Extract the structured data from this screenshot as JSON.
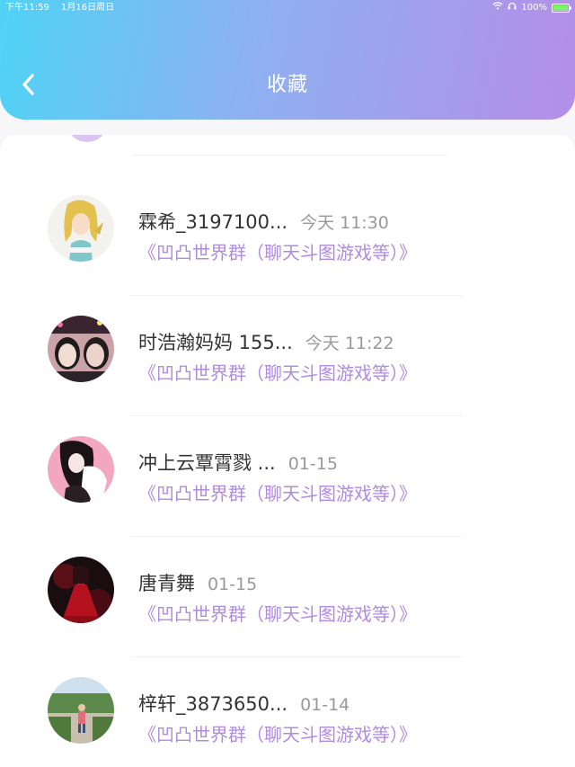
{
  "status_bar": {
    "time": "下午11:59",
    "date": "1月16日周日",
    "battery": "100%",
    "battery_level": 1.0
  },
  "header": {
    "title": "收藏",
    "back_icon": "chevron-left-icon"
  },
  "colors": {
    "gradient_start": "#4fd3f6",
    "gradient_end": "#b48ee8",
    "group_text": "#b08be0",
    "name_text": "#333333",
    "time_text": "#999999"
  },
  "favorites": [
    {
      "name": "霖希_3197100...",
      "time": "今天 11:30",
      "group": "《凹凸世界群（聊天斗图游戏等）》",
      "avatar": "anime-blonde-girl-avatar"
    },
    {
      "name": "时浩瀚妈妈 155...",
      "time": "今天 11:22",
      "group": "《凹凸世界群（聊天斗图游戏等）》",
      "avatar": "couple-photo-avatar"
    },
    {
      "name": "冲上云覃霄戮 ...",
      "time": "01-15",
      "group": "《凹凸世界群（聊天斗图游戏等）》",
      "avatar": "anime-dark-hair-avatar"
    },
    {
      "name": "唐青舞",
      "time": "01-15",
      "group": "《凹凸世界群（聊天斗图游戏等）》",
      "avatar": "red-dress-anime-avatar"
    },
    {
      "name": "梓轩_3873650...",
      "time": "01-14",
      "group": "《凹凸世界群（聊天斗图游戏等）》",
      "avatar": "outdoor-child-photo-avatar"
    }
  ]
}
